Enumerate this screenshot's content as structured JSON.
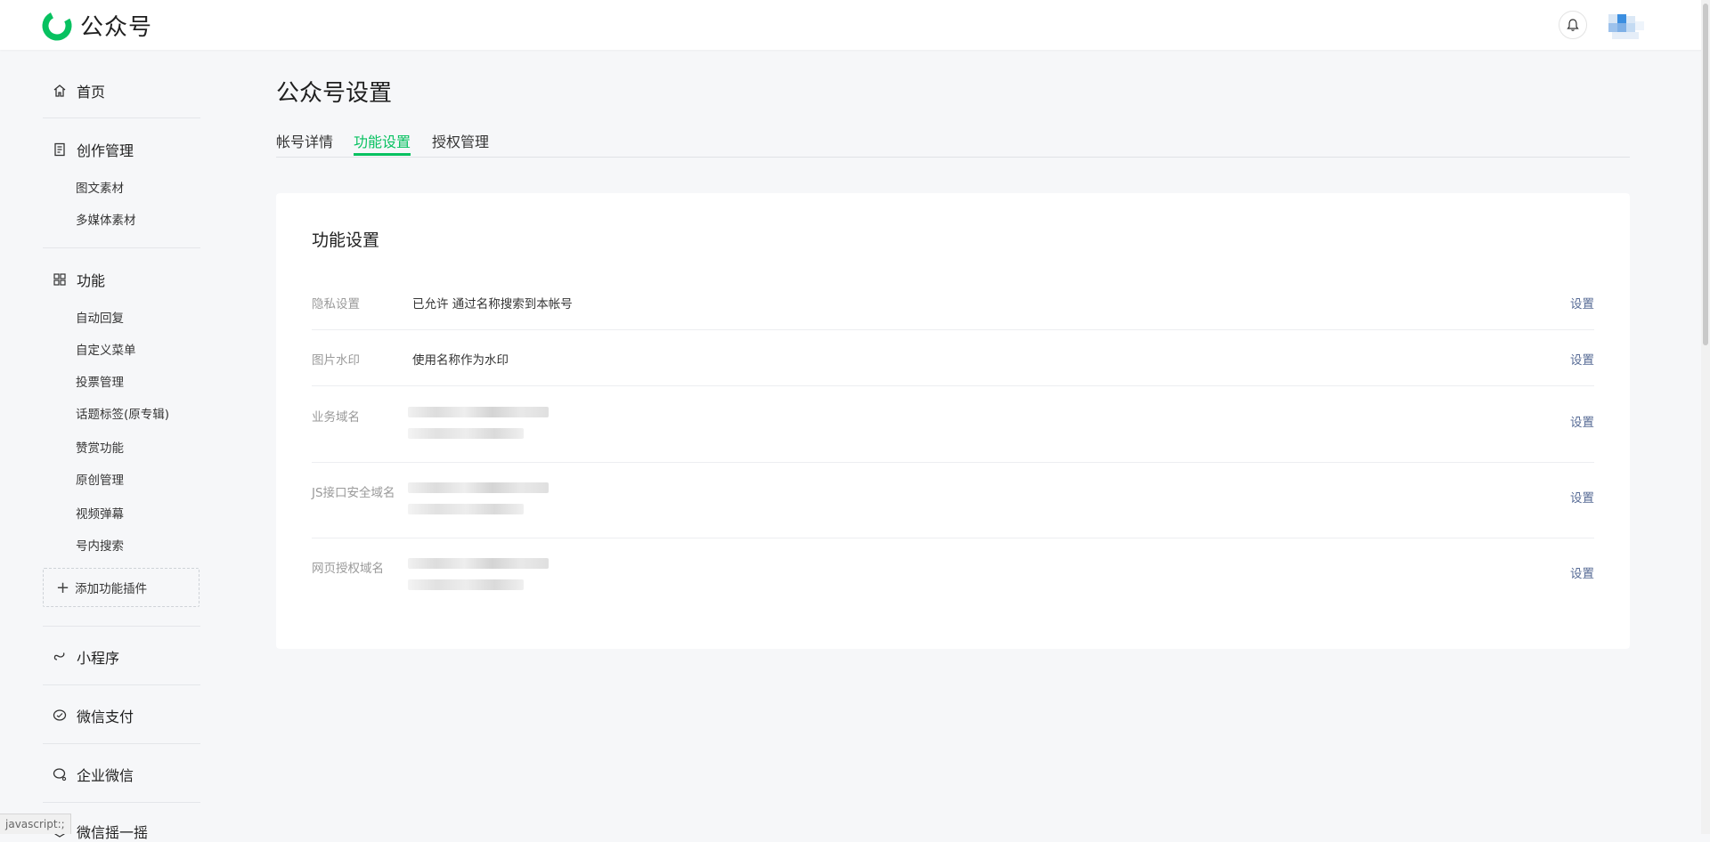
{
  "brand": {
    "name": "公众号"
  },
  "page": {
    "title": "公众号设置"
  },
  "tabs": [
    {
      "label": "帐号详情"
    },
    {
      "label": "功能设置"
    },
    {
      "label": "授权管理"
    }
  ],
  "sidebar": {
    "home": "首页",
    "creation": {
      "label": "创作管理",
      "items": [
        "图文素材",
        "多媒体素材"
      ]
    },
    "features": {
      "label": "功能",
      "items": [
        "自动回复",
        "自定义菜单",
        "投票管理",
        "话题标签(原专辑)",
        "赞赏功能",
        "原创管理",
        "视频弹幕",
        "号内搜索"
      ]
    },
    "add_plugin": "添加功能插件",
    "mini_program": "小程序",
    "wechat_pay": "微信支付",
    "wecom": "企业微信",
    "shake": "微信摇一摇"
  },
  "card": {
    "title": "功能设置",
    "action_label": "设置",
    "rows": [
      {
        "label": "隐私设置",
        "value": "已允许 通过名称搜索到本帐号"
      },
      {
        "label": "图片水印",
        "value": "使用名称作为水印"
      },
      {
        "label": "业务域名",
        "value": ""
      },
      {
        "label": "JS接口安全域名",
        "value": ""
      },
      {
        "label": "网页授权域名",
        "value": ""
      }
    ]
  },
  "status_hint": "javascript:;",
  "colors": {
    "accent": "#07c160",
    "link": "#576b95",
    "background": "#f6f7f9"
  },
  "icons": {
    "home": "home-icon",
    "creation": "document-icon",
    "features": "grid-icon",
    "mini_program": "link-icon",
    "pay": "chat-bubble-icon",
    "wecom": "chat-icon",
    "bell": "bell-icon"
  }
}
